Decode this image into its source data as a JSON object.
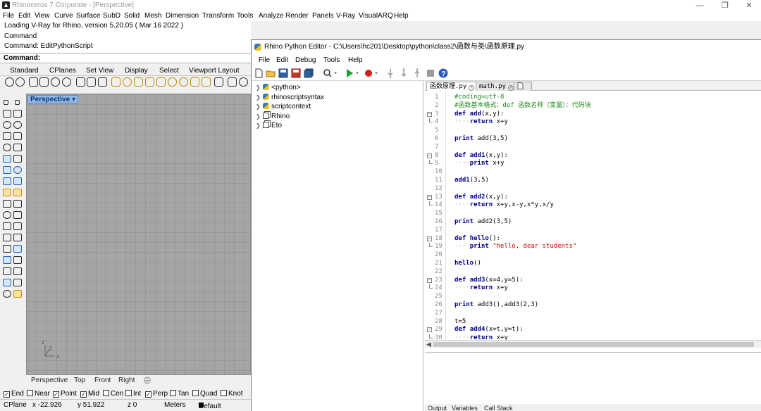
{
  "rhino": {
    "title": "Rhinoceros 7 Corporate - [Perspective]",
    "menu": [
      "File",
      "Edit",
      "View",
      "Curve",
      "Surface",
      "SubD",
      "Solid",
      "Mesh",
      "Dimension",
      "Transform",
      "Tools",
      "Analyze",
      "Render",
      "Panels",
      "V-Ray",
      "VisualARQ",
      "Help"
    ],
    "command_history": [
      "Loading V-Ray for Rhino, version 5.20.05 ( Mar 16 2022 )",
      "Command",
      "Command: EditPythonScript"
    ],
    "command_prompt": "Command:",
    "toolbar_tabs": [
      "Standard",
      "CPlanes",
      "Set View",
      "Display",
      "Select",
      "Viewport Layout"
    ],
    "viewport": {
      "label": "Perspective",
      "axis_y": "y",
      "axis_x": "x",
      "axis_z": "z"
    },
    "view_tabs": [
      "Perspective",
      "Top",
      "Front",
      "Right"
    ],
    "view_tabs_add_icon": "plus-icon",
    "osnaps": [
      {
        "label": "End",
        "checked": true
      },
      {
        "label": "Near",
        "checked": false
      },
      {
        "label": "Point",
        "checked": true
      },
      {
        "label": "Mid",
        "checked": true
      },
      {
        "label": "Cen",
        "checked": false
      },
      {
        "label": "Int",
        "checked": false
      },
      {
        "label": "Perp",
        "checked": true
      },
      {
        "label": "Tan",
        "checked": false
      },
      {
        "label": "Quad",
        "checked": false
      },
      {
        "label": "Knot",
        "checked": false
      }
    ],
    "status": {
      "cplane": "CPlane",
      "x": "x -22.926",
      "y": "y 51.922",
      "z": "z 0",
      "units": "Meters",
      "layer": "Default"
    }
  },
  "editor": {
    "title": "Rhino Python Editor - C:\\Users\\hc201\\Desktop\\python\\class2\\函数与类\\函数原理.py",
    "menu": [
      "File",
      "Edit",
      "Debug",
      "Tools",
      "Help"
    ],
    "tree": [
      {
        "label": "<python>",
        "icon": "python-icon"
      },
      {
        "label": "rhinoscriptsyntax",
        "icon": "python-icon"
      },
      {
        "label": "scriptcontext",
        "icon": "python-icon"
      },
      {
        "label": "Rhino",
        "icon": "namespace-icon"
      },
      {
        "label": "Eto",
        "icon": "namespace-icon"
      }
    ],
    "tabs": [
      {
        "label": "函数原理.py",
        "active": true
      },
      {
        "label": "math.py",
        "active": false
      }
    ],
    "code_lines": [
      {
        "n": "1",
        "text": "#coding=utf-8"
      },
      {
        "n": "2",
        "text": "#函数基本格式：def 函数名称（变量）：代码块"
      },
      {
        "n": "3",
        "kw": "def",
        "name": "add",
        "rest": "(x,y):"
      },
      {
        "n": "4",
        "dots": "····",
        "kw": "return",
        "rest": " x+y"
      },
      {
        "n": "5"
      },
      {
        "n": "6",
        "kw": "print",
        "rest": " add(3,5)"
      },
      {
        "n": "7"
      },
      {
        "n": "8",
        "kw": "def",
        "name": "add1",
        "rest": "(x,y):"
      },
      {
        "n": "9",
        "dots": "····",
        "kw": "print",
        "rest": " x+y"
      },
      {
        "n": "10"
      },
      {
        "n": "11",
        "name": "add1",
        "rest": "(3,5)"
      },
      {
        "n": "12"
      },
      {
        "n": "13",
        "kw": "def",
        "name": "add2",
        "rest": "(x,y):"
      },
      {
        "n": "14",
        "dots": "····",
        "kw": "return",
        "rest": " x+y,x-y,x*y,x/y"
      },
      {
        "n": "15"
      },
      {
        "n": "16",
        "kw": "print",
        "rest": " add2(3,5)"
      },
      {
        "n": "17"
      },
      {
        "n": "18",
        "kw": "def",
        "name": "hello",
        "rest": "():"
      },
      {
        "n": "19",
        "dots": "····",
        "kw": "print",
        "str": " \"hello, dear students\""
      },
      {
        "n": "20"
      },
      {
        "n": "21",
        "name": "hello",
        "rest": "()"
      },
      {
        "n": "22"
      },
      {
        "n": "23",
        "kw": "def",
        "name": "add3",
        "rest": "(x=4,y=5):"
      },
      {
        "n": "24",
        "dots": "····",
        "kw": "return",
        "rest": " x+y"
      },
      {
        "n": "25"
      },
      {
        "n": "26",
        "kw": "print",
        "rest": " add3(),add3(2,3)"
      },
      {
        "n": "27"
      },
      {
        "n": "28",
        "rest": "t=5"
      },
      {
        "n": "29",
        "kw": "def",
        "name": "add4",
        "rest": "(x=t,y=t):"
      },
      {
        "n": "30",
        "dots": "····",
        "kw": "return",
        "rest": " x+y"
      }
    ],
    "output_tabs": [
      "Output",
      "Variables",
      "Call Stack"
    ]
  },
  "colors": {
    "viewport_bg": "#a5a5a5",
    "viewport_label": "#8fb9ea",
    "comment": "#1f8a1f",
    "keyword": "#00008b",
    "string": "#d00000"
  }
}
